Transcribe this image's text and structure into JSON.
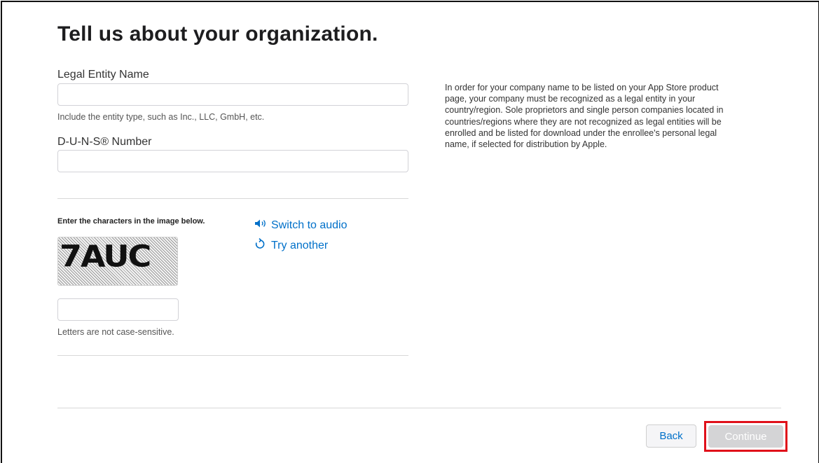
{
  "page": {
    "title": "Tell us about your organization."
  },
  "form": {
    "legal_entity_label": "Legal Entity Name",
    "legal_entity_value": "",
    "legal_entity_hint": "Include the entity type, such as Inc., LLC, GmbH, etc.",
    "duns_label": "D-U-N-S® Number",
    "duns_value": ""
  },
  "info_text": "In order for your company name to be listed on your App Store product page, your company must be recognized as a legal entity in your country/region. Sole proprietors and single person companies located in countries/regions where they are not recognized as legal entities will be enrolled and be listed for download under the enrollee's personal legal name, if selected for distribution by Apple.",
  "captcha": {
    "prompt": "Enter the characters in the image below.",
    "image_text": "7AUC",
    "switch_audio_label": "Switch to audio",
    "try_another_label": "Try another",
    "input_value": "",
    "hint": "Letters are not case-sensitive."
  },
  "buttons": {
    "back_label": "Back",
    "continue_label": "Continue"
  },
  "colors": {
    "link": "#0070c9",
    "highlight": "#e0101a",
    "continue_disabled": "#d4d4d6"
  },
  "icons": {
    "speaker": "speaker-icon",
    "refresh": "refresh-icon"
  }
}
